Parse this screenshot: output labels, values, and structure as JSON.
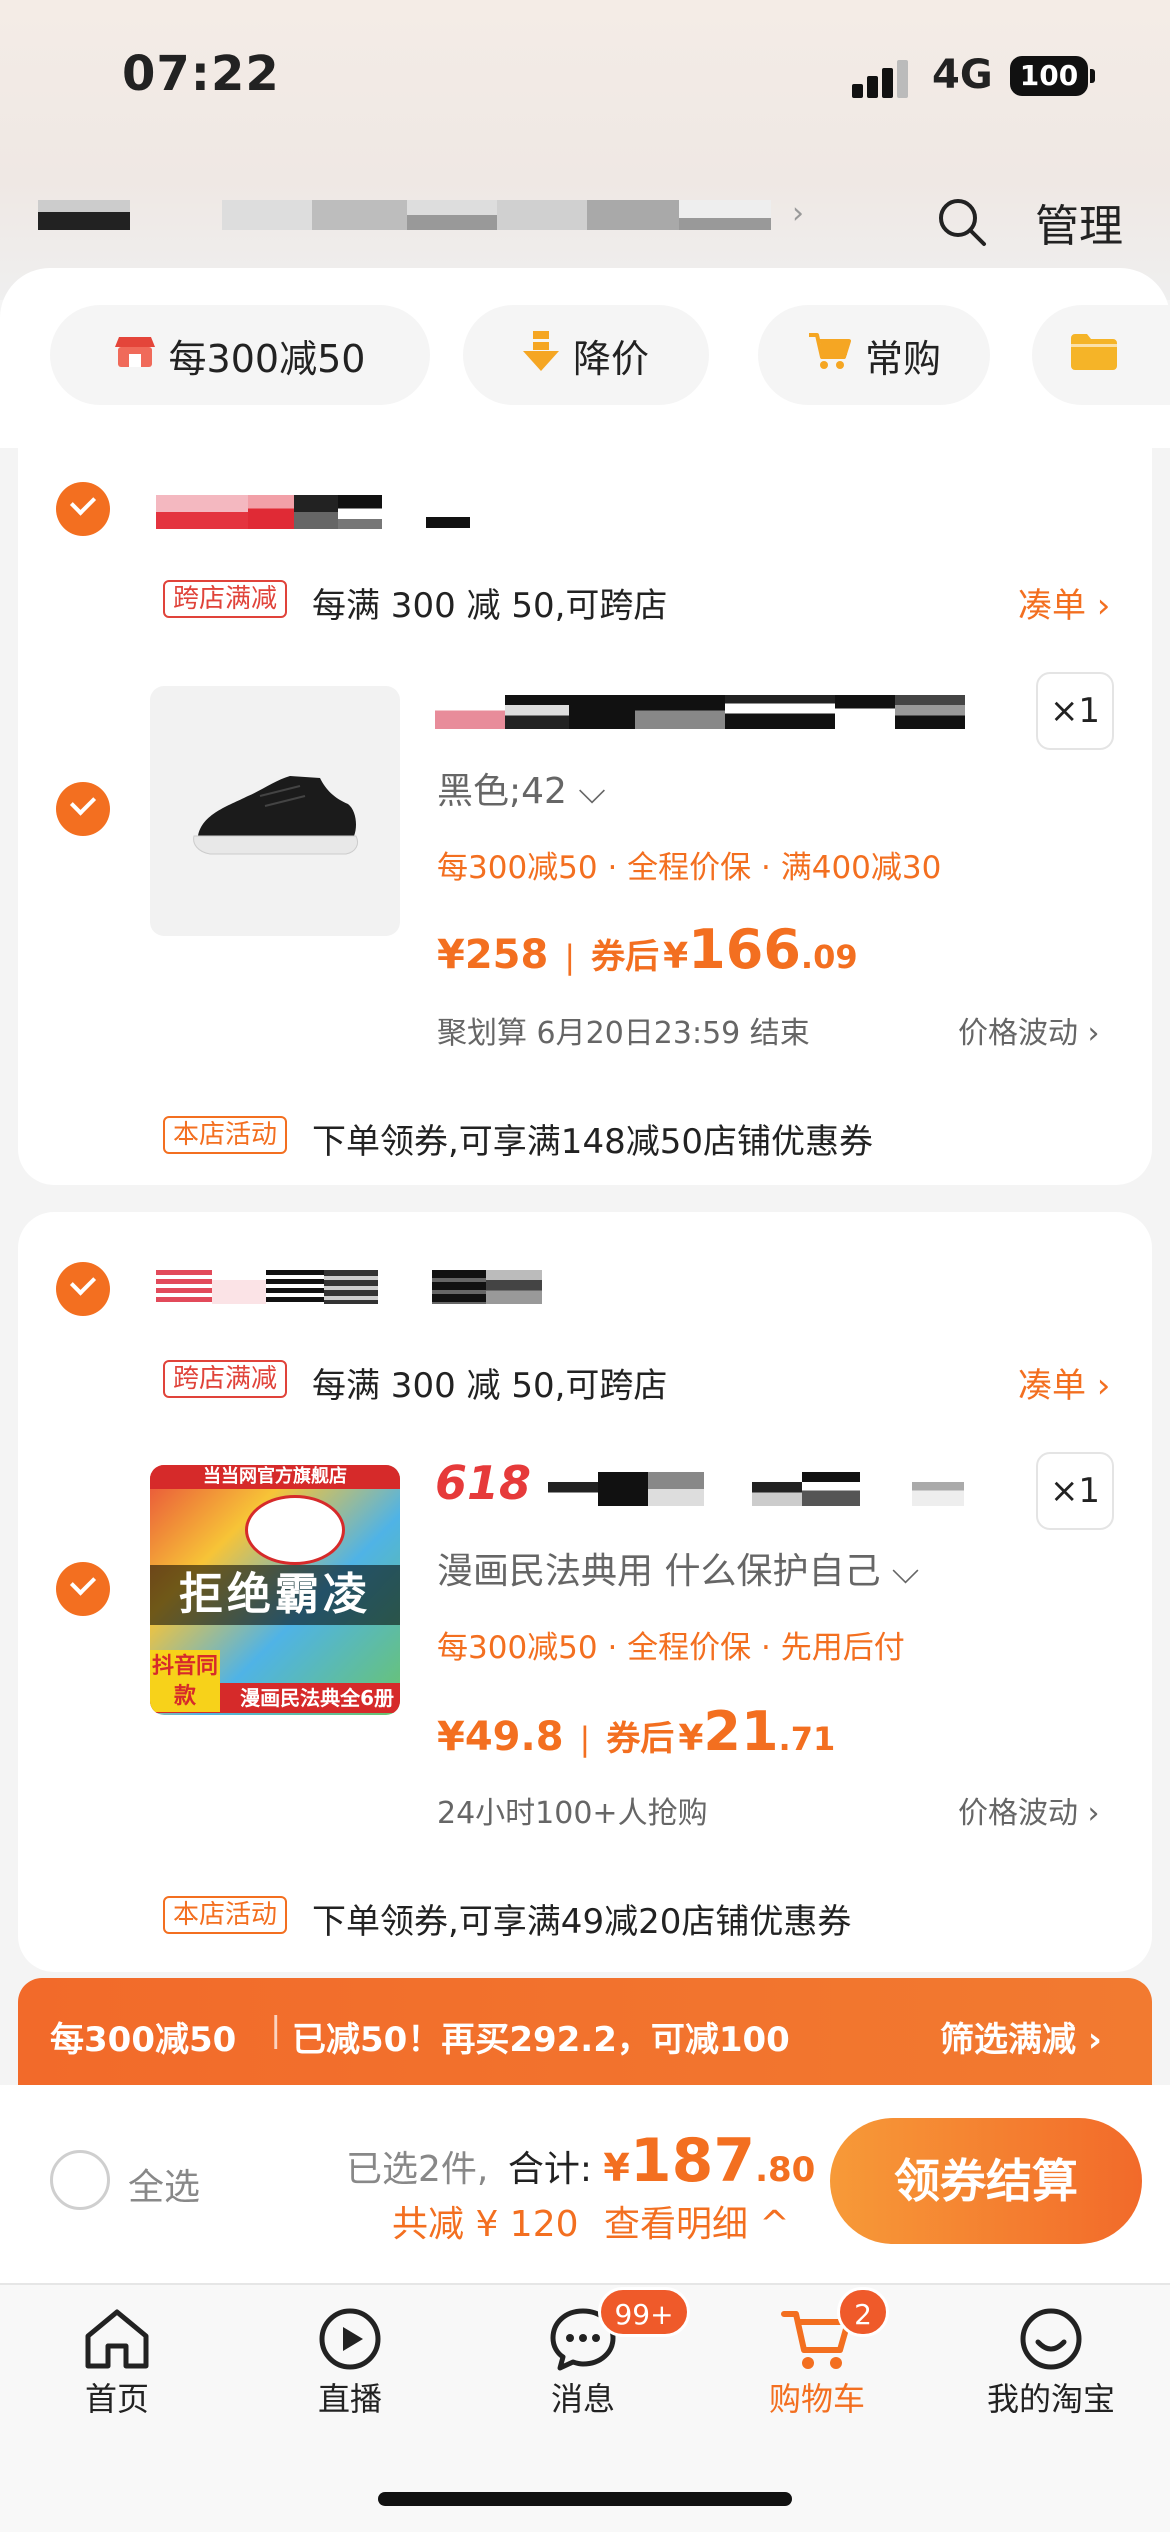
{
  "status_bar": {
    "time": "07:22",
    "network": "4G",
    "battery": "100"
  },
  "header": {
    "manage_label": "管理"
  },
  "filters": [
    {
      "label": "每300减50",
      "icon": "store-icon"
    },
    {
      "label": "降价",
      "icon": "price-down-icon"
    },
    {
      "label": "常购",
      "icon": "cart-icon"
    },
    {
      "label": "",
      "icon": "folder-icon"
    }
  ],
  "shops": [
    {
      "cross_tag": "跨店满减",
      "cross_text": "每满 300 减 50,可跨店",
      "cou_link": "凑单 ›",
      "item": {
        "sku": "黑色;42 ⌵",
        "promos": "每300减50 · 全程价保 · 满400减30",
        "price": "¥258",
        "after_label": "券后",
        "after_currency": "¥",
        "after_int": "166",
        "after_dec": ".09",
        "sub_left": "聚划算 6月20日23:59 结束",
        "sub_right": "价格波动 ›",
        "qty": "×1"
      },
      "store_tag": "本店活动",
      "store_text": "下单领券,可享满148减50店铺优惠券"
    },
    {
      "cross_tag": "跨店满减",
      "cross_text": "每满 300 减 50,可跨店",
      "cou_link": "凑单 ›",
      "item": {
        "badge618": "618",
        "thumb_shop": "当当网官方旗舰店",
        "thumb_title": "拒绝霸凌",
        "thumb_sub": "漫画民法典全6册",
        "thumb_corner": "抖音同款",
        "sku": "漫画民法典用 什么保护自己 ⌵",
        "promos": "每300减50 · 全程价保 · 先用后付",
        "price": "¥49.8",
        "after_label": "券后",
        "after_currency": "¥",
        "after_int": "21",
        "after_dec": ".71",
        "sub_left": "24小时100+人抢购",
        "sub_right": "价格波动 ›",
        "qty": "×1"
      },
      "store_tag": "本店活动",
      "store_text": "下单领券,可享满49减20店铺优惠券"
    }
  ],
  "coupon_bar": {
    "left": "每300减50",
    "middle": "已减50！再买292.2，可减100",
    "right": "筛选满减 ›"
  },
  "checkout": {
    "select_all": "全选",
    "selected": "已选2件,",
    "total_label": "合计:",
    "total_currency": "¥",
    "total_int": "187",
    "total_dec": ".80",
    "discount": "共减 ¥ 120",
    "detail": "查看明细 ^",
    "button": "领券结算"
  },
  "tabs": [
    {
      "label": "首页",
      "icon": "home-icon"
    },
    {
      "label": "直播",
      "icon": "live-icon"
    },
    {
      "label": "消息",
      "icon": "message-icon",
      "badge": "99+"
    },
    {
      "label": "购物车",
      "icon": "cart-icon",
      "badge": "2",
      "active": true
    },
    {
      "label": "我的淘宝",
      "icon": "profile-icon"
    }
  ],
  "colors": {
    "accent": "#f36f20",
    "red": "#e0433a"
  }
}
